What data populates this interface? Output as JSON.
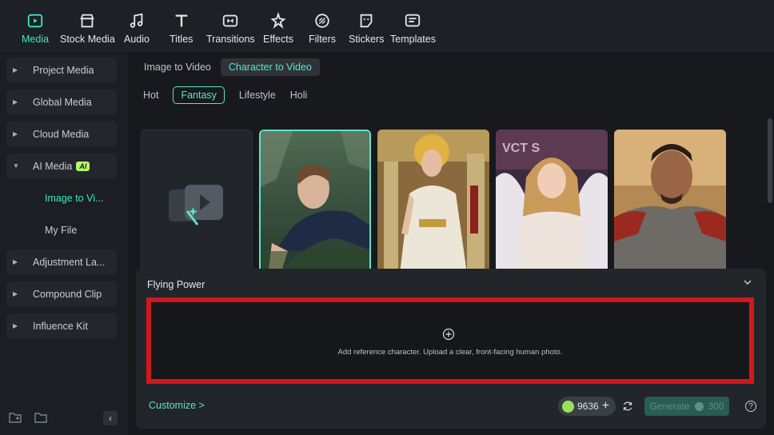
{
  "toolbar": {
    "items": [
      {
        "label": "Media",
        "icon": "media-icon",
        "active": true
      },
      {
        "label": "Stock Media",
        "icon": "stock-media-icon"
      },
      {
        "label": "Audio",
        "icon": "audio-icon"
      },
      {
        "label": "Titles",
        "icon": "titles-icon"
      },
      {
        "label": "Transitions",
        "icon": "transitions-icon"
      },
      {
        "label": "Effects",
        "icon": "effects-icon"
      },
      {
        "label": "Filters",
        "icon": "filters-icon"
      },
      {
        "label": "Stickers",
        "icon": "stickers-icon"
      },
      {
        "label": "Templates",
        "icon": "templates-icon"
      }
    ]
  },
  "sidebar": {
    "items": [
      {
        "label": "Project Media"
      },
      {
        "label": "Global Media"
      },
      {
        "label": "Cloud Media"
      },
      {
        "label": "AI Media",
        "badge": "AI",
        "expanded": true
      },
      {
        "label": "Image to Vi...",
        "sub": true,
        "active": true
      },
      {
        "label": "My File",
        "sub": true
      },
      {
        "label": "Adjustment La..."
      },
      {
        "label": "Compound Clip"
      },
      {
        "label": "Influence Kit"
      }
    ]
  },
  "main": {
    "tabs": [
      {
        "label": "Image to Video"
      },
      {
        "label": "Character to Video",
        "active": true
      }
    ],
    "categories": [
      {
        "label": "Hot"
      },
      {
        "label": "Fantasy",
        "active": true
      },
      {
        "label": "Lifestyle"
      },
      {
        "label": "Holi"
      }
    ],
    "panel": {
      "title": "Flying Power",
      "drop_hint": "Add reference character. Upload a clear, front-facing human photo.",
      "customize": "Customize >",
      "credits": "9636",
      "generate_label": "Generate",
      "generate_cost": "300"
    }
  },
  "colors": {
    "accent": "#38e8c5",
    "highlight_border": "#d0191c",
    "ai_badge": "#b4f76a"
  }
}
